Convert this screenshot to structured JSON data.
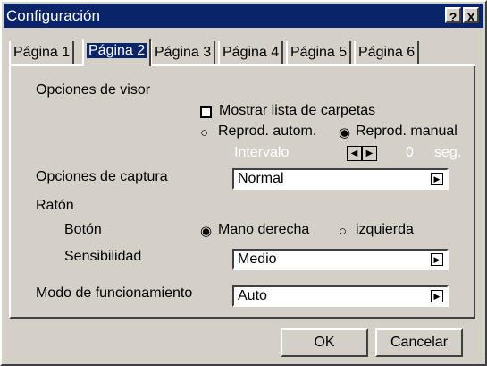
{
  "window": {
    "title": "Configuración",
    "help_icon": "?",
    "close_icon": "X"
  },
  "tabs": [
    {
      "label": "Página 1",
      "active": false
    },
    {
      "label": "Página 2",
      "active": true
    },
    {
      "label": "Página 3",
      "active": false
    },
    {
      "label": "Página 4",
      "active": false
    },
    {
      "label": "Página 5",
      "active": false
    },
    {
      "label": "Página 6",
      "active": false
    }
  ],
  "viewer": {
    "heading": "Opciones de visor",
    "show_folder_list": {
      "label": "Mostrar lista de carpetas",
      "checked": false
    },
    "auto_play": {
      "label": "Reprod. autom.",
      "selected": false
    },
    "manual_play": {
      "label": "Reprod. manual",
      "selected": true
    },
    "interval": {
      "label": "Intervalo",
      "value": "0",
      "unit": "seg.",
      "enabled": false
    }
  },
  "capture": {
    "label": "Opciones de captura",
    "value": "Normal"
  },
  "mouse": {
    "heading": "Ratón",
    "button_label": "Botón",
    "right_hand": {
      "label": "Mano derecha",
      "selected": true
    },
    "left_hand": {
      "label": "izquierda",
      "selected": false
    },
    "sensitivity_label": "Sensibilidad",
    "sensitivity_value": "Medio"
  },
  "operation_mode": {
    "label": "Modo de funcionamiento",
    "value": "Auto"
  },
  "buttons": {
    "ok": "OK",
    "cancel": "Cancelar"
  },
  "icons": {
    "dropdown": "dropdown-arrow-icon",
    "left": "left-arrow-icon",
    "right": "right-arrow-icon"
  }
}
